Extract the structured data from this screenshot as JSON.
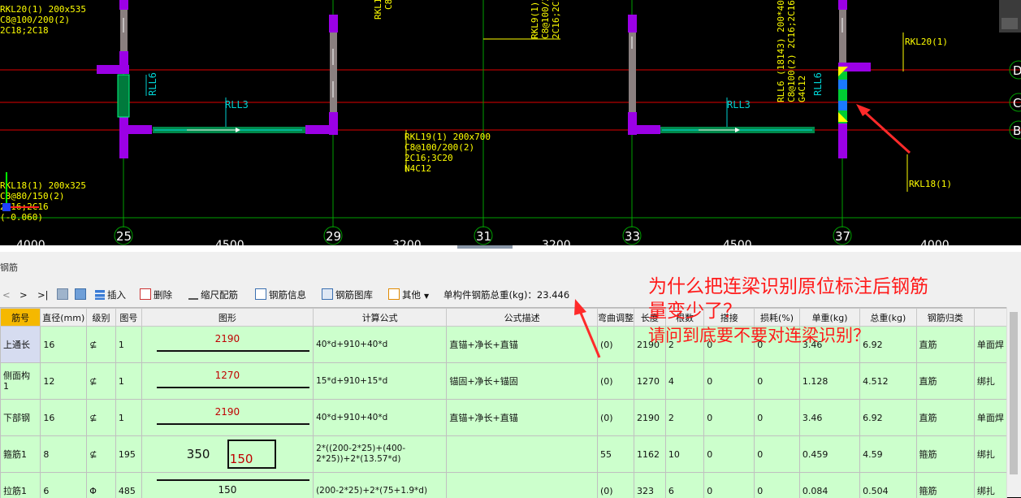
{
  "cad": {
    "axis_numbers": [
      "25",
      "29",
      "31",
      "33",
      "37"
    ],
    "axis_letters": [
      "D",
      "C",
      "B"
    ],
    "spacing_labels": [
      "4000",
      "4500",
      "3200",
      "3200",
      "4500",
      "4000"
    ],
    "labels": {
      "rkl20_top_left": [
        "RKL20(1) 200x535",
        "C8@100/200(2)",
        "2C18;2C18"
      ],
      "rll6_left": "RLL6",
      "rll3_left": "RLL3",
      "rkl19": [
        "RKL19(1) 200x700",
        "C8@100/200(2)",
        "2C16;3C20",
        "N4C12"
      ],
      "rkl19_top": [
        "RKL1",
        "C8"
      ],
      "rkl9_top": [
        "RKL9(1) 2",
        "C8@100/2",
        "2C16;2C1"
      ],
      "rll3_right": "RLL3",
      "rll6_right": [
        "RLL6 (18143) 200*400",
        "C8@100(2) 2C16;2C16",
        "G4C12",
        "RLL6"
      ],
      "rkl20_right": "RKL20(1)",
      "rkl18_right": "RKL18(1)",
      "rkl18_left": [
        "RKL18(1) 200x325",
        "C8@80/150(2)",
        "2C16;2C16",
        "(-0.060)"
      ]
    }
  },
  "panel": {
    "title": "钢筋",
    "toolbar": {
      "prev": "<",
      "next": ">",
      "last": ">|",
      "insert": "插入",
      "delete": "删除",
      "scale_rebar": "缩尺配筋",
      "rebar_info": "钢筋信息",
      "rebar_library": "钢筋图库",
      "other": "其他",
      "total_weight": "单构件钢筋总重(kg)：23.446"
    },
    "columns": [
      "筋号",
      "直径(mm)",
      "级别",
      "图号",
      "图形",
      "计算公式",
      "公式描述",
      "弯曲调整",
      "长度",
      "根数",
      "搭接",
      "损耗(%)",
      "单重(kg)",
      "总重(kg)",
      "钢筋归类",
      ""
    ],
    "rows": [
      {
        "name": "上通长",
        "diameter": "16",
        "grade": "⊈",
        "fig": "1",
        "shape_len": "2190",
        "formula": "40*d+910+40*d",
        "desc": "直锚+净长+直锚",
        "bend": "(0)",
        "length": "2190",
        "count": "2",
        "lap": "0",
        "loss": "0",
        "unit_wt": "3.46",
        "total_wt": "6.92",
        "category": "直筋",
        "extra": "单面焊"
      },
      {
        "name": "侧面构\n1",
        "diameter": "12",
        "grade": "⊈",
        "fig": "1",
        "shape_len": "1270",
        "formula": "15*d+910+15*d",
        "desc": "锚固+净长+锚固",
        "bend": "(0)",
        "length": "1270",
        "count": "4",
        "lap": "0",
        "loss": "0",
        "unit_wt": "1.128",
        "total_wt": "4.512",
        "category": "直筋",
        "extra": "绑扎"
      },
      {
        "name": "下部钢",
        "diameter": "16",
        "grade": "⊈",
        "fig": "1",
        "shape_len": "2190",
        "formula": "40*d+910+40*d",
        "desc": "直锚+净长+直锚",
        "bend": "(0)",
        "length": "2190",
        "count": "2",
        "lap": "0",
        "loss": "0",
        "unit_wt": "3.46",
        "total_wt": "6.92",
        "category": "直筋",
        "extra": "单面焊"
      },
      {
        "name": "箍筋1",
        "diameter": "8",
        "grade": "⊈",
        "fig": "195",
        "shape_a": "350",
        "shape_b": "150",
        "formula": "2*((200-2*25)+(400-2*25))+2*(13.57*d)",
        "desc": "",
        "bend": "55",
        "length": "1162",
        "count": "10",
        "lap": "0",
        "loss": "0",
        "unit_wt": "0.459",
        "total_wt": "4.59",
        "category": "箍筋",
        "extra": "绑扎"
      },
      {
        "name": "拉筋1",
        "diameter": "6",
        "grade": "Φ",
        "fig": "485",
        "shape_len": "150",
        "formula": "(200-2*25)+2*(75+1.9*d)",
        "desc": "",
        "bend": "(0)",
        "length": "323",
        "count": "6",
        "lap": "0",
        "loss": "0",
        "unit_wt": "0.084",
        "total_wt": "0.504",
        "category": "箍筋",
        "extra": "绑扎"
      }
    ]
  },
  "annotation": {
    "line1": "为什么把连梁识别原位标注后钢筋",
    "line2": "量变少了？",
    "line3": "请问到底要不要对连梁识别？"
  },
  "colors": {
    "column_purple": "#9b00e6",
    "grid_red": "#e00000",
    "grid_green": "#00a000",
    "beam_green": "#00b060",
    "cad_text_yellow": "#ffff00",
    "annotation_red": "#ff1a1a",
    "row_green": "#ccffcc"
  }
}
